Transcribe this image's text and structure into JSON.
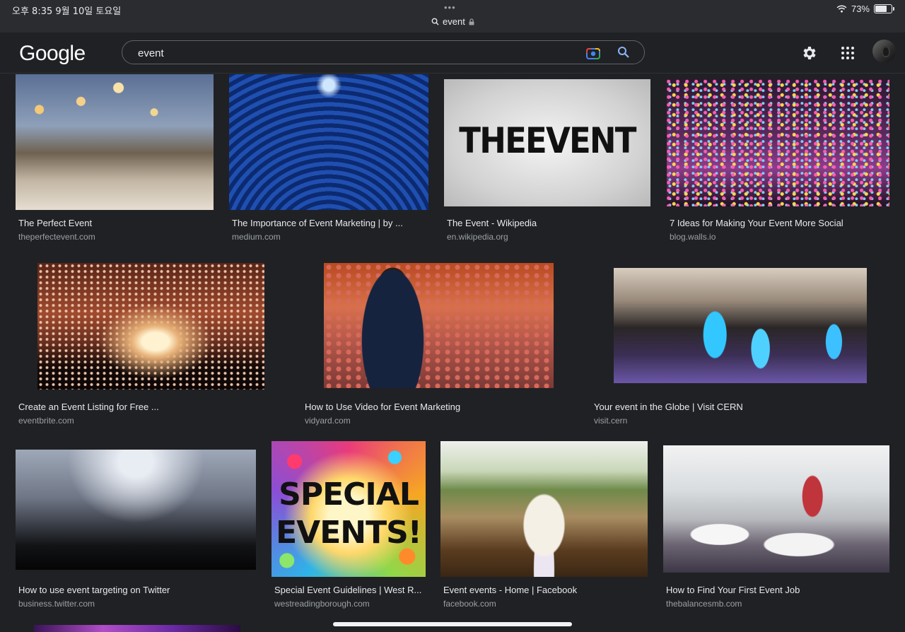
{
  "status": {
    "time": "오후 8:35  9월 10일 토요일",
    "dots": "•••",
    "url": "event",
    "battery": "73%",
    "battery_level": 0.73
  },
  "header": {
    "logo": "Google",
    "search_value": "event"
  },
  "results": [
    {
      "title": "The Perfect Event",
      "source": "theperfectevent.com"
    },
    {
      "title": "The Importance of Event Marketing | by ...",
      "source": "medium.com"
    },
    {
      "title": "The Event - Wikipedia",
      "source": "en.wikipedia.org",
      "image_text": "THEEVENT"
    },
    {
      "title": "7 Ideas for Making Your Event More Social",
      "source": "blog.walls.io"
    },
    {
      "title": "Create an Event Listing for Free ...",
      "source": "eventbrite.com"
    },
    {
      "title": "How to Use Video for Event Marketing",
      "source": "vidyard.com"
    },
    {
      "title": "Your event in the Globe | Visit CERN",
      "source": "visit.cern"
    },
    {
      "title": "How to use event targeting on Twitter",
      "source": "business.twitter.com"
    },
    {
      "title": "Special Event Guidelines | West R...",
      "source": "westreadingborough.com",
      "image_text_1": "SPECIAL",
      "image_text_2": "EVENTS!"
    },
    {
      "title": "Event events - Home | Facebook",
      "source": "facebook.com"
    },
    {
      "title": "How to Find Your First Event Job",
      "source": "thebalancesmb.com"
    }
  ]
}
